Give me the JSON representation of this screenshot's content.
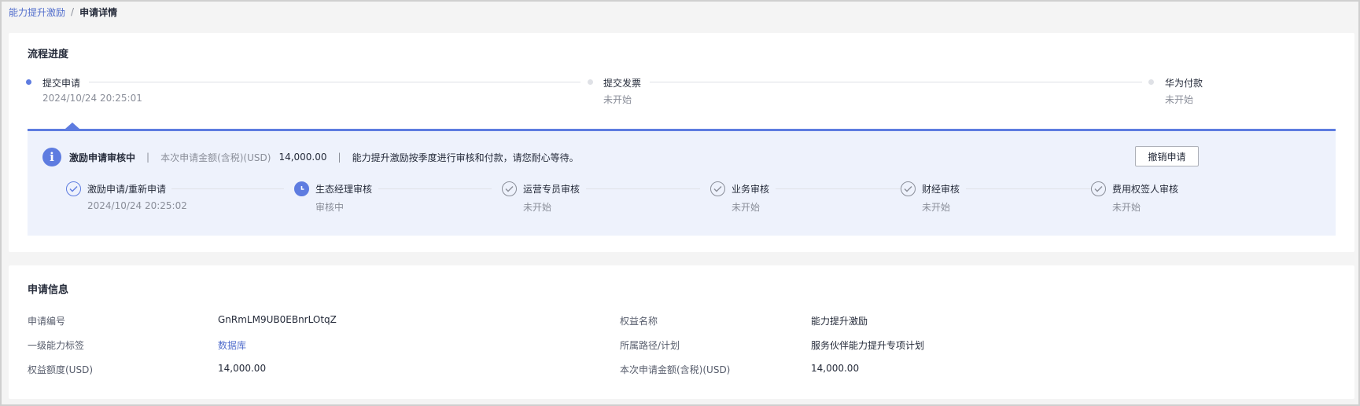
{
  "breadcrumb": {
    "parent": "能力提升激励",
    "separator": "/",
    "current": "申请详情"
  },
  "progress": {
    "title": "流程进度",
    "steps": [
      {
        "label": "提交申请",
        "sub": "2024/10/24 20:25:01",
        "state": "active"
      },
      {
        "label": "提交发票",
        "sub": "未开始",
        "state": "pending"
      },
      {
        "label": "华为付款",
        "sub": "未开始",
        "state": "pending"
      }
    ]
  },
  "review": {
    "info_icon_glyph": "i",
    "status": "激励申请审核中",
    "separator": "|",
    "amount_label": "本次申请金额(含税)(USD)",
    "amount_value": "14,000.00",
    "notice": "能力提升激励按季度进行审核和付款，请您耐心等待。",
    "cancel_label": "撤销申请",
    "steps": [
      {
        "label": "激励申请/重新申请",
        "sub": "2024/10/24 20:25:02",
        "state": "done"
      },
      {
        "label": "生态经理审核",
        "sub": "审核中",
        "state": "current"
      },
      {
        "label": "运营专员审核",
        "sub": "未开始",
        "state": "pending"
      },
      {
        "label": "业务审核",
        "sub": "未开始",
        "state": "pending"
      },
      {
        "label": "财经审核",
        "sub": "未开始",
        "state": "pending"
      },
      {
        "label": "费用权签人审核",
        "sub": "未开始",
        "state": "pending"
      }
    ]
  },
  "info": {
    "title": "申请信息",
    "fields": [
      {
        "label": "申请编号",
        "value": "GnRmLM9UB0EBnrLOtqZ"
      },
      {
        "label": "权益名称",
        "value": "能力提升激励"
      },
      {
        "label": "一级能力标签",
        "value": "数据库"
      },
      {
        "label": "所属路径/计划",
        "value": "服务伙伴能力提升专项计划"
      },
      {
        "label": "权益额度(USD)",
        "value": "14,000.00"
      },
      {
        "label": "本次申请金额(含税)(USD)",
        "value": "14,000.00"
      }
    ]
  },
  "colors": {
    "accent": "#5e7ce0",
    "link": "#526ecc",
    "panel_bg": "#eef2fc",
    "muted": "#8a8e99"
  }
}
